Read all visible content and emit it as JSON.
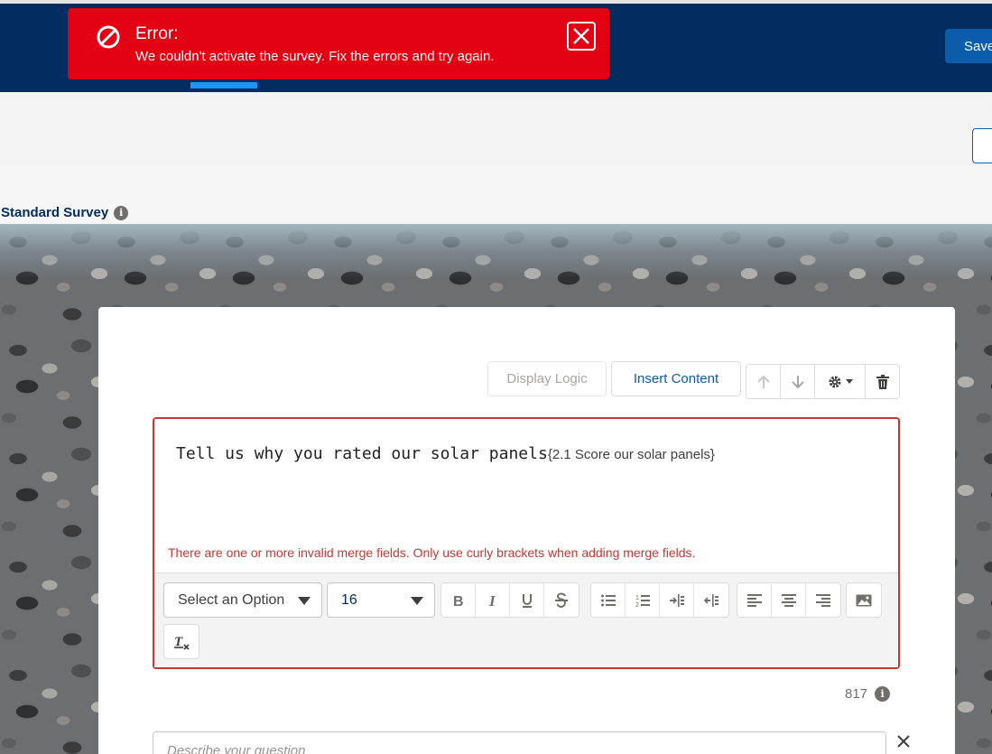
{
  "header": {
    "save_label": "Save"
  },
  "toast": {
    "title": "Error:",
    "message": "We couldn't activate the survey. Fix the errors and try again.",
    "icon": "ban-icon",
    "close_icon": "close-icon",
    "color": "#e40012"
  },
  "survey": {
    "type_label": "Standard Survey",
    "info_glyph": "i"
  },
  "toolbar": {
    "display_logic_label": "Display Logic",
    "insert_content_label": "Insert Content"
  },
  "question": {
    "text": "Tell us why you rated our solar panels",
    "merge_text": "{2.1 Score our solar panels}",
    "error": "There are one or more invalid merge fields. Only use curly brackets when adding merge fields."
  },
  "editor": {
    "font_select": "Select an Option",
    "size_select": "16",
    "char_count": "817"
  },
  "description": {
    "placeholder": "Describe your question"
  },
  "colors": {
    "header_bg": "#032d60",
    "brand_blue": "#0b5cab",
    "error_red": "#c23934"
  }
}
